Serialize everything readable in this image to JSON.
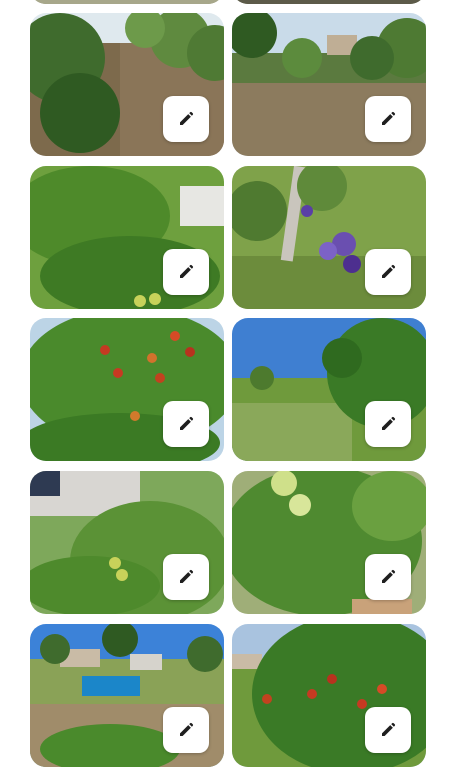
{
  "gallery": {
    "tiles": [
      {
        "alt": "garden-path-trees",
        "edit_icon": "pencil-icon"
      },
      {
        "alt": "orchard-rows",
        "edit_icon": "pencil-icon"
      },
      {
        "alt": "cherry-branch",
        "edit_icon": "pencil-icon"
      },
      {
        "alt": "iris-flower-tree",
        "edit_icon": "pencil-icon"
      },
      {
        "alt": "red-cherries-tree",
        "edit_icon": "pencil-icon"
      },
      {
        "alt": "garden-lane-sky",
        "edit_icon": "pencil-icon"
      },
      {
        "alt": "young-fruit-tree-house",
        "edit_icon": "pencil-icon"
      },
      {
        "alt": "green-apples",
        "edit_icon": "pencil-icon"
      },
      {
        "alt": "yard-with-pool",
        "edit_icon": "pencil-icon"
      },
      {
        "alt": "cherry-tree-yard",
        "edit_icon": "pencil-icon"
      }
    ]
  },
  "colors": {
    "background": "#ffffff",
    "button": "#ffffff",
    "icon": "#1f1f1f"
  }
}
